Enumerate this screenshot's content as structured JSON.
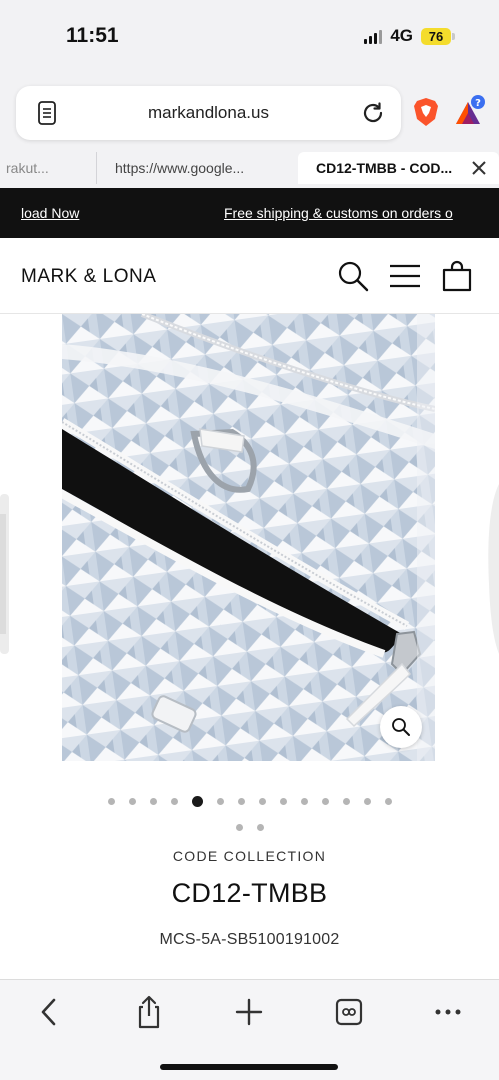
{
  "status_bar": {
    "time": "11:51",
    "network": "4G",
    "battery": "76"
  },
  "browser": {
    "url": "markandlona.us",
    "tabs": [
      {
        "label": "rakut..."
      },
      {
        "label": "https://www.google..."
      },
      {
        "label": "CD12-TMBB - COD..."
      }
    ]
  },
  "announcement": {
    "left": "load Now",
    "right": "Free shipping & customs on orders o"
  },
  "header": {
    "logo": "MARK & LONA"
  },
  "gallery": {
    "dots_total": 16,
    "active_index": 4
  },
  "product": {
    "collection": "CODE COLLECTION",
    "title": "CD12-TMBB",
    "sku": "MCS-5A-SB5100191002"
  },
  "colors": {
    "announcement_bg": "#111111",
    "battery": "#f4dc2c",
    "brave": "#fb542b"
  }
}
